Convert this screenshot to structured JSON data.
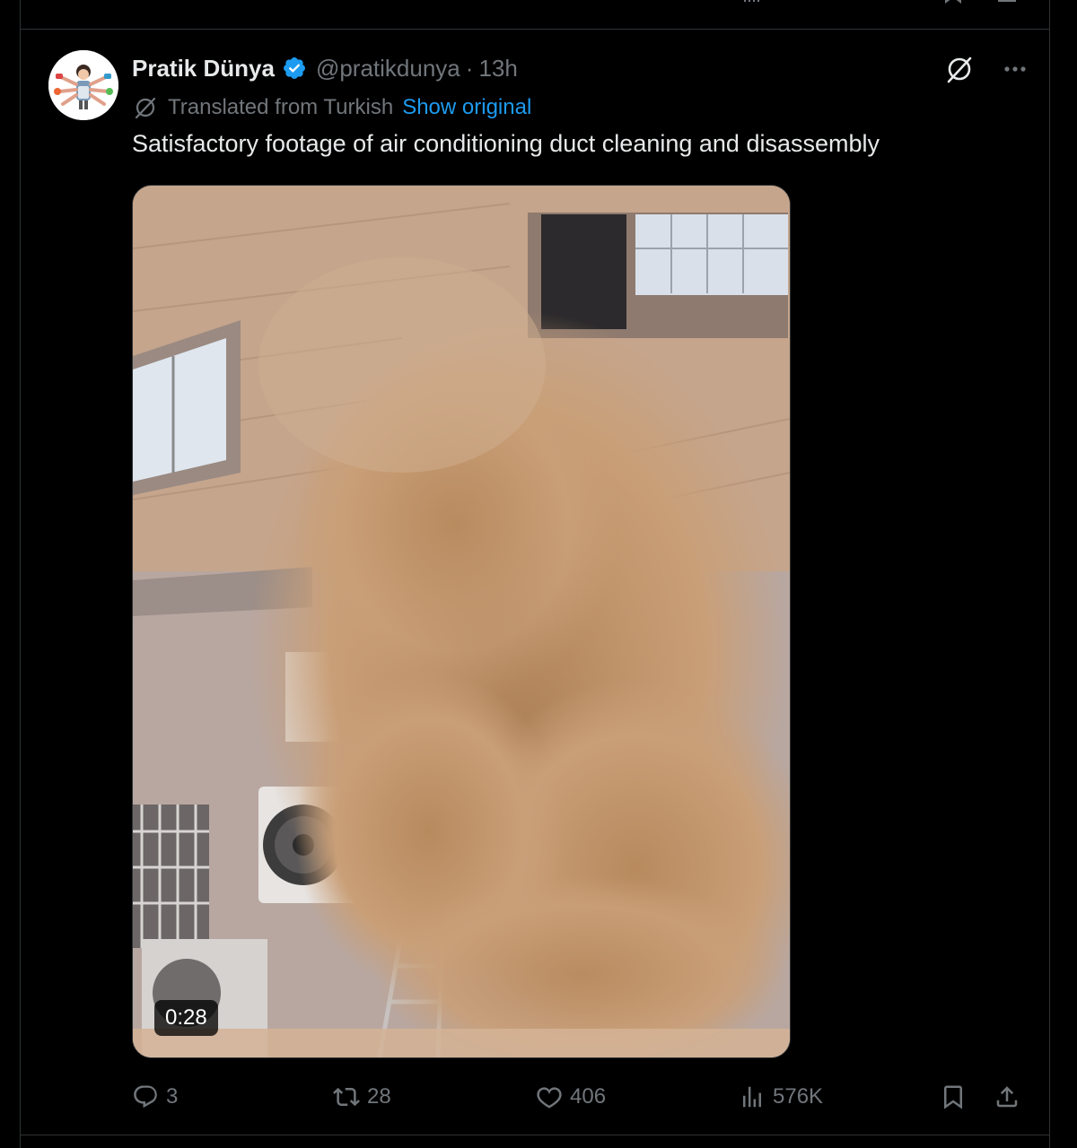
{
  "tweet": {
    "author": {
      "display_name": "Pratik Dünya",
      "handle": "@pratikdunya",
      "verified": true
    },
    "separator": "·",
    "time": "13h",
    "translation": {
      "label": "Translated from Turkish",
      "show_original_label": "Show original"
    },
    "text": "Satisfactory footage of air conditioning duct cleaning and disassembly",
    "media": {
      "type": "video",
      "duration": "0:28"
    },
    "stats": {
      "replies": "3",
      "reposts": "28",
      "likes": "406",
      "views": "576K"
    }
  },
  "icons": {
    "verified": "verified-badge-icon",
    "grok": "grok-icon",
    "more": "more-options-icon",
    "translate": "grok-translate-icon",
    "reply": "reply-icon",
    "repost": "repost-icon",
    "like": "heart-icon",
    "views": "views-chart-icon",
    "bookmark": "bookmark-icon",
    "share": "share-icon"
  },
  "colors": {
    "background": "#000000",
    "primary_text": "#e7e9ea",
    "secondary_text": "#71767b",
    "accent": "#1d9bf0",
    "border": "#2f3336"
  }
}
